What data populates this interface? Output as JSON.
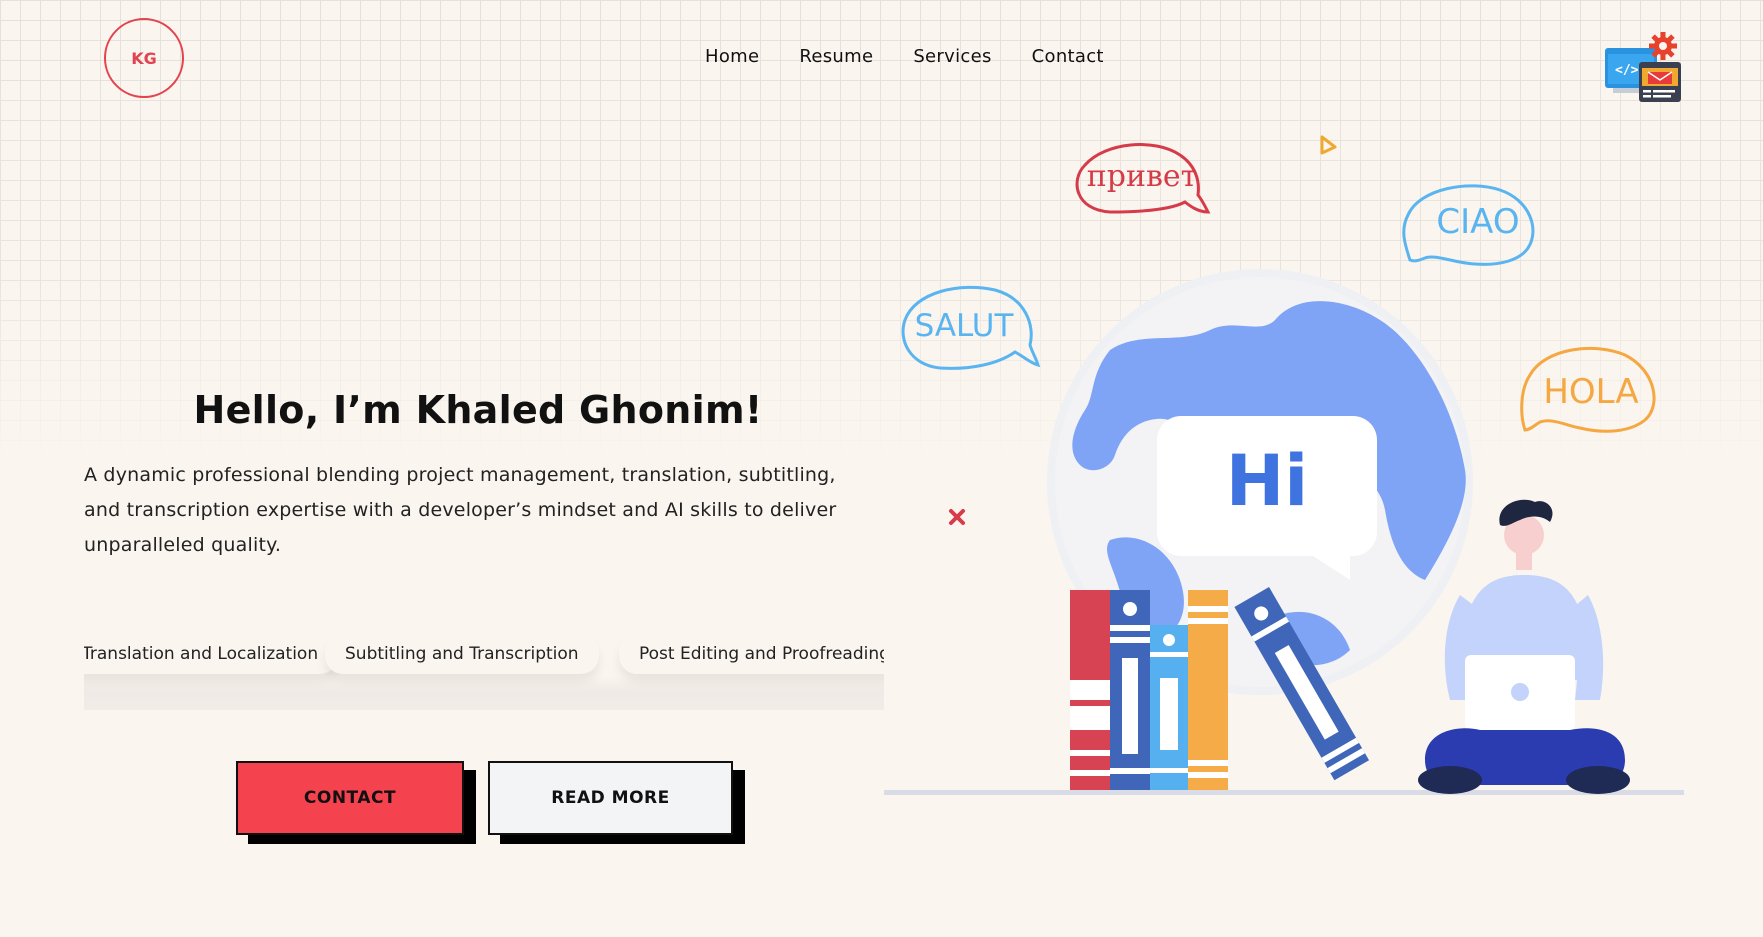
{
  "brand": {
    "logo_text": "KG",
    "accent": "#e2444f"
  },
  "nav": {
    "items": [
      "Home",
      "Resume",
      "Services",
      "Contact"
    ]
  },
  "hero": {
    "title": "Hello, I’m Khaled Ghonim!",
    "description": "A dynamic professional blending project management, translation, subtitling, and transcription expertise with a developer’s mindset and AI skills to deliver unparalleled quality."
  },
  "skills": [
    "Translation and Localization",
    "Subtitling and Transcription",
    "Post Editing and Proofreading"
  ],
  "buttons": {
    "contact": "CONTACT",
    "read_more": "READ MORE",
    "contact_color": "#f5424f"
  },
  "illustration": {
    "bubbles": [
      "привет",
      "CIAO",
      "SALUT",
      "HOLA"
    ],
    "greeting": "Hi"
  },
  "icons": {
    "top_right": "web-development-gear-icon",
    "close": "close-x-icon",
    "play": "play-triangle-icon"
  }
}
